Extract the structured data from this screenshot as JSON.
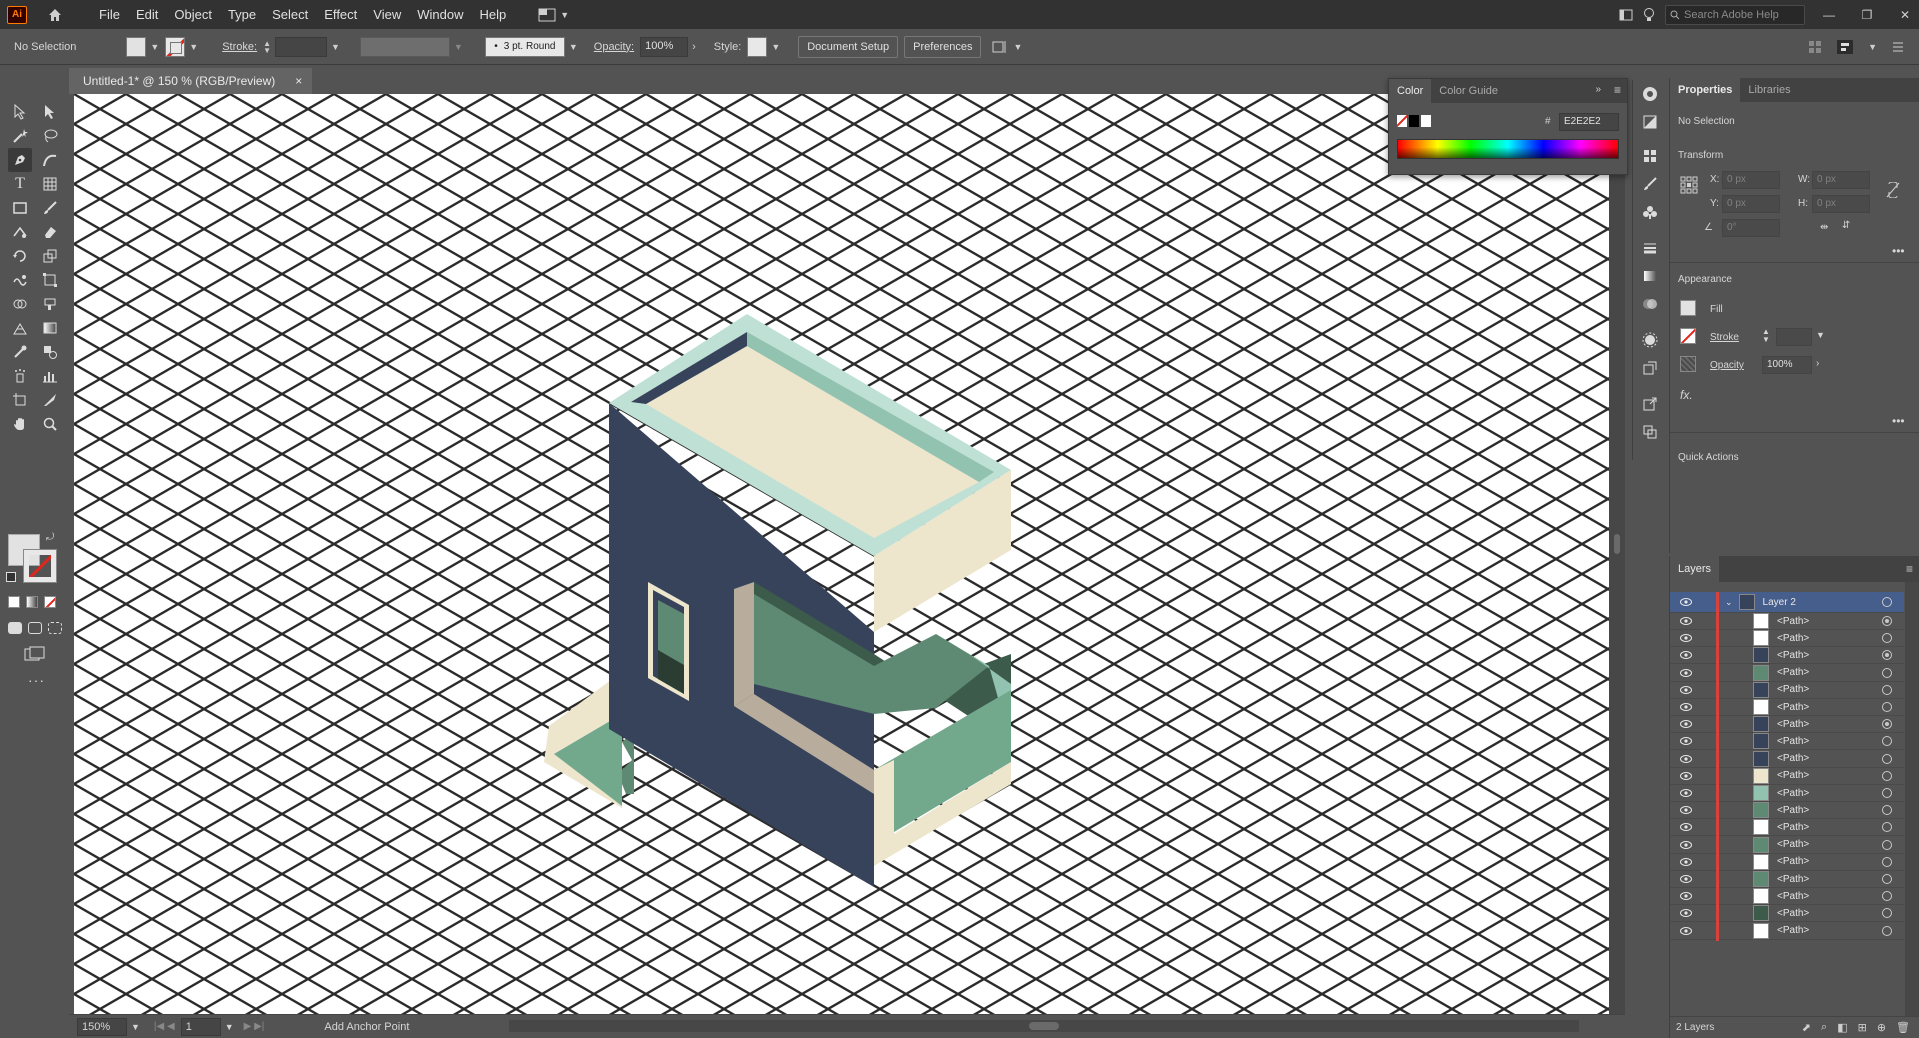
{
  "app": {
    "logo_text": "Ai",
    "menus": [
      "File",
      "Edit",
      "Object",
      "Type",
      "Select",
      "Effect",
      "View",
      "Window",
      "Help"
    ],
    "search_placeholder": "Search Adobe Help"
  },
  "control_bar": {
    "selection_label": "No Selection",
    "stroke_label": "Stroke:",
    "brush_label": "3 pt. Round",
    "opacity_label": "Opacity:",
    "opacity_value": "100%",
    "style_label": "Style:",
    "document_setup": "Document Setup",
    "preferences": "Preferences"
  },
  "document": {
    "tab_title": "Untitled-1* @ 150 % (RGB/Preview)",
    "close_glyph": "×"
  },
  "status_bar": {
    "zoom": "150%",
    "page": "1",
    "tool_hint": "Add Anchor Point"
  },
  "color_panel": {
    "tabs": [
      "Color",
      "Color Guide"
    ],
    "hex_label": "#",
    "hex_value": "E2E2E2"
  },
  "properties_panel": {
    "tabs": [
      "Properties",
      "Libraries"
    ],
    "selection": "No Selection",
    "transform_title": "Transform",
    "x_label": "X:",
    "y_label": "Y:",
    "w_label": "W:",
    "h_label": "H:",
    "x_value": "0 px",
    "y_value": "0 px",
    "w_value": "0 px",
    "h_value": "0 px",
    "angle_value": "0°",
    "appearance_title": "Appearance",
    "fill_label": "Fill",
    "stroke_label": "Stroke",
    "opacity_label": "Opacity",
    "opacity_value": "100%",
    "fx_label": "fx.",
    "quick_actions_title": "Quick Actions"
  },
  "layers_panel": {
    "title": "Layers",
    "top_layer": "Layer 2",
    "path_label": "<Path>",
    "footer_count": "2 Layers",
    "rows": [
      {
        "name": "<Path>",
        "target": "filled"
      },
      {
        "name": "<Path>",
        "target": "empty"
      },
      {
        "name": "<Path>",
        "target": "filled"
      },
      {
        "name": "<Path>",
        "target": "empty"
      },
      {
        "name": "<Path>",
        "target": "empty"
      },
      {
        "name": "<Path>",
        "target": "empty"
      },
      {
        "name": "<Path>",
        "target": "filled"
      },
      {
        "name": "<Path>",
        "target": "empty"
      },
      {
        "name": "<Path>",
        "target": "empty"
      },
      {
        "name": "<Path>",
        "target": "empty"
      },
      {
        "name": "<Path>",
        "target": "empty"
      },
      {
        "name": "<Path>",
        "target": "empty"
      },
      {
        "name": "<Path>",
        "target": "empty"
      },
      {
        "name": "<Path>",
        "target": "empty"
      },
      {
        "name": "<Path>",
        "target": "empty"
      },
      {
        "name": "<Path>",
        "target": "empty"
      },
      {
        "name": "<Path>",
        "target": "empty"
      },
      {
        "name": "<Path>",
        "target": "empty"
      },
      {
        "name": "<Path>",
        "target": "empty"
      }
    ]
  },
  "artwork": {
    "grid_color": "#2b2b2b",
    "colors": {
      "wall_front": "#37425b",
      "roof_inner": "#ede5cc",
      "parapet_top": "#bfe0d4",
      "parapet_inner": "#92c2b0",
      "cream_side": "#ede5cc",
      "glass_dark": "#3d5b4b",
      "glass_mid": "#5e8a73",
      "floor_green": "#72a98c",
      "recess_beige": "#b8ad9c",
      "window_frame": "#ede5cc"
    }
  },
  "accent": "#465e8c"
}
